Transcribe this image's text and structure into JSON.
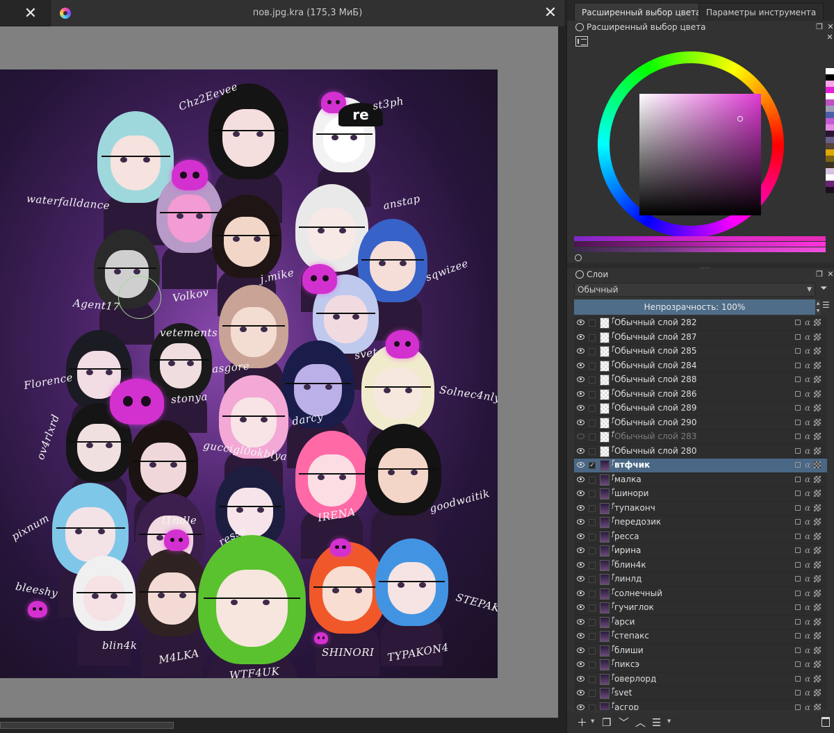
{
  "window": {
    "document_title": "пов.jpg.kra (175,3 МиБ)"
  },
  "canvas": {
    "names": [
      "Chz2Eevee",
      "st3ph",
      "waterfalldance",
      "anstap",
      "Agent17",
      "Volkov",
      "j.mike",
      "sqwizee",
      "Florence",
      "vetements",
      "asgore",
      "svet",
      "stonya",
      "Solnec4nly",
      "ov4rlxrd",
      "guccigl0okblya",
      "darcy",
      "goodwaitik",
      "pixnum",
      "l1ndle",
      "IRENA",
      "ressa",
      "bleeshy",
      "blin4k",
      "M4LKA",
      "WTF4UK",
      "SHINORI",
      "TYPAKON4",
      "STEPAKS"
    ],
    "cap_text": "re"
  },
  "docker": {
    "tabs": [
      {
        "label": "Расширенный выбор цвета",
        "active": true
      },
      {
        "label": "Параметры инструмента",
        "active": false
      }
    ],
    "color_panel_title": "Расширенный выбор цвета",
    "swatches": [
      "#ffffff",
      "#000000",
      "#f7a8e6",
      "#e51fd8",
      "#ffffff",
      "#c14fc5",
      "#9d9db5",
      "#4b5ea6",
      "#c25bd4",
      "#e38be0",
      "#2a1533",
      "#6a5f8a",
      "#57433a",
      "#e1a800",
      "#7b6416",
      "#3b3121",
      "#d8c3df",
      "#ffffff",
      "#6b2377",
      "#1e0d21"
    ],
    "layers_panel_title": "Слои",
    "blend_mode": "Обычный",
    "opacity_label": "Непрозрачность:  100%"
  },
  "layers": [
    {
      "name": "Обычный слой 282",
      "visible": true,
      "thumb": "transparent",
      "active": false,
      "checked": false
    },
    {
      "name": "Обычный слой 287",
      "visible": true,
      "thumb": "transparent",
      "active": false,
      "checked": false
    },
    {
      "name": "Обычный слой 285",
      "visible": true,
      "thumb": "transparent",
      "active": false,
      "checked": false
    },
    {
      "name": "Обычный слой 284",
      "visible": true,
      "thumb": "transparent",
      "active": false,
      "checked": false
    },
    {
      "name": "Обычный слой 288",
      "visible": true,
      "thumb": "transparent",
      "active": false,
      "checked": false
    },
    {
      "name": "Обычный слой 286",
      "visible": true,
      "thumb": "transparent",
      "active": false,
      "checked": false
    },
    {
      "name": "Обычный слой 289",
      "visible": true,
      "thumb": "transparent",
      "active": false,
      "checked": false
    },
    {
      "name": "Обычный слой 290",
      "visible": true,
      "thumb": "transparent",
      "active": false,
      "checked": false
    },
    {
      "name": "Обычный слой 283",
      "visible": false,
      "thumb": "transparent",
      "active": false,
      "checked": false
    },
    {
      "name": "Обычный слой 280",
      "visible": true,
      "thumb": "transparent",
      "active": false,
      "checked": false
    },
    {
      "name": "втфчик",
      "visible": true,
      "thumb": "image",
      "active": true,
      "checked": true
    },
    {
      "name": "малка",
      "visible": true,
      "thumb": "image",
      "active": false,
      "checked": false
    },
    {
      "name": "шинори",
      "visible": true,
      "thumb": "image",
      "active": false,
      "checked": false
    },
    {
      "name": "тупаконч",
      "visible": true,
      "thumb": "image",
      "active": false,
      "checked": false
    },
    {
      "name": "передозик",
      "visible": true,
      "thumb": "image",
      "active": false,
      "checked": false
    },
    {
      "name": "ресса",
      "visible": true,
      "thumb": "image",
      "active": false,
      "checked": false
    },
    {
      "name": "ирина",
      "visible": true,
      "thumb": "image",
      "active": false,
      "checked": false
    },
    {
      "name": "блин4к",
      "visible": true,
      "thumb": "image",
      "active": false,
      "checked": false
    },
    {
      "name": "линлд",
      "visible": true,
      "thumb": "image",
      "active": false,
      "checked": false
    },
    {
      "name": "солнечный",
      "visible": true,
      "thumb": "image",
      "active": false,
      "checked": false
    },
    {
      "name": "гучиглок",
      "visible": true,
      "thumb": "image",
      "active": false,
      "checked": false
    },
    {
      "name": "арси",
      "visible": true,
      "thumb": "image",
      "active": false,
      "checked": false
    },
    {
      "name": "степакс",
      "visible": true,
      "thumb": "image",
      "active": false,
      "checked": false
    },
    {
      "name": "блиши",
      "visible": true,
      "thumb": "image",
      "active": false,
      "checked": false
    },
    {
      "name": "пиксэ",
      "visible": true,
      "thumb": "image",
      "active": false,
      "checked": false
    },
    {
      "name": "оверлорд",
      "visible": true,
      "thumb": "image",
      "active": false,
      "checked": false
    },
    {
      "name": "svet",
      "visible": true,
      "thumb": "image",
      "active": false,
      "checked": false
    },
    {
      "name": "асгор",
      "visible": true,
      "thumb": "image",
      "active": false,
      "checked": false
    }
  ],
  "layer_toolbar": {
    "icons": [
      "add-layer-icon",
      "duplicate-layer-icon",
      "move-layer-down-icon",
      "move-layer-up-icon",
      "layer-properties-icon",
      "delete-layer-icon"
    ]
  },
  "colors": {
    "accent_selection": "#4a6885",
    "opacity_bar": "#4f6d88",
    "canvas_bg": "#808080"
  }
}
